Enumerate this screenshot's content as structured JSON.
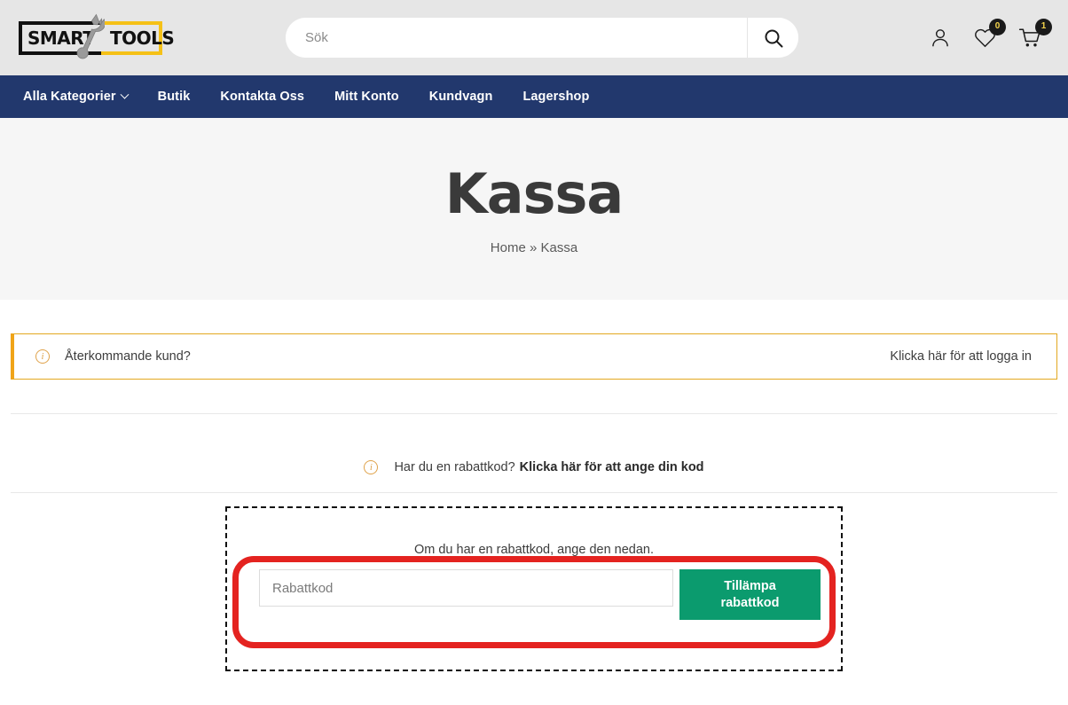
{
  "header": {
    "logo": {
      "word_left": "SMART",
      "word_right": "TOOLS",
      "icon": "wrench-icon"
    },
    "search": {
      "placeholder": "Sök",
      "value": "",
      "icon": "search-icon"
    },
    "account_icon": "user-icon",
    "wishlist": {
      "icon": "heart-icon",
      "count": "0"
    },
    "cart": {
      "icon": "cart-icon",
      "count": "1"
    }
  },
  "nav": {
    "items": [
      {
        "label": "Alla Kategorier",
        "has_chevron": true
      },
      {
        "label": "Butik",
        "has_chevron": false
      },
      {
        "label": "Kontakta Oss",
        "has_chevron": false
      },
      {
        "label": "Mitt Konto",
        "has_chevron": false
      },
      {
        "label": "Kundvagn",
        "has_chevron": false
      },
      {
        "label": "Lagershop",
        "has_chevron": false
      }
    ]
  },
  "hero": {
    "title": "Kassa",
    "breadcrumb_home": "Home",
    "breadcrumb_sep": "»",
    "breadcrumb_current": "Kassa"
  },
  "login_notice": {
    "icon": "info-icon",
    "icon_glyph": "i",
    "text": "Återkommande kund?",
    "link": "Klicka här för att logga in"
  },
  "coupon_notice": {
    "icon": "info-icon",
    "icon_glyph": "i",
    "text": "Har du en rabattkod?",
    "link": "Klicka här för att ange din kod"
  },
  "coupon_form": {
    "hint": "Om du har en rabattkod, ange den nedan.",
    "input_placeholder": "Rabattkod",
    "input_value": "",
    "apply_line1": "Tillämpa",
    "apply_line2": "rabattkod"
  },
  "colors": {
    "nav_bg": "#22386d",
    "header_bg": "#e6e6e6",
    "hero_bg": "#f6f6f6",
    "accent_yellow": "#f5c117",
    "notice_border": "#e3a820",
    "apply_green": "#0b9b6e",
    "highlight_red": "#e42320"
  }
}
